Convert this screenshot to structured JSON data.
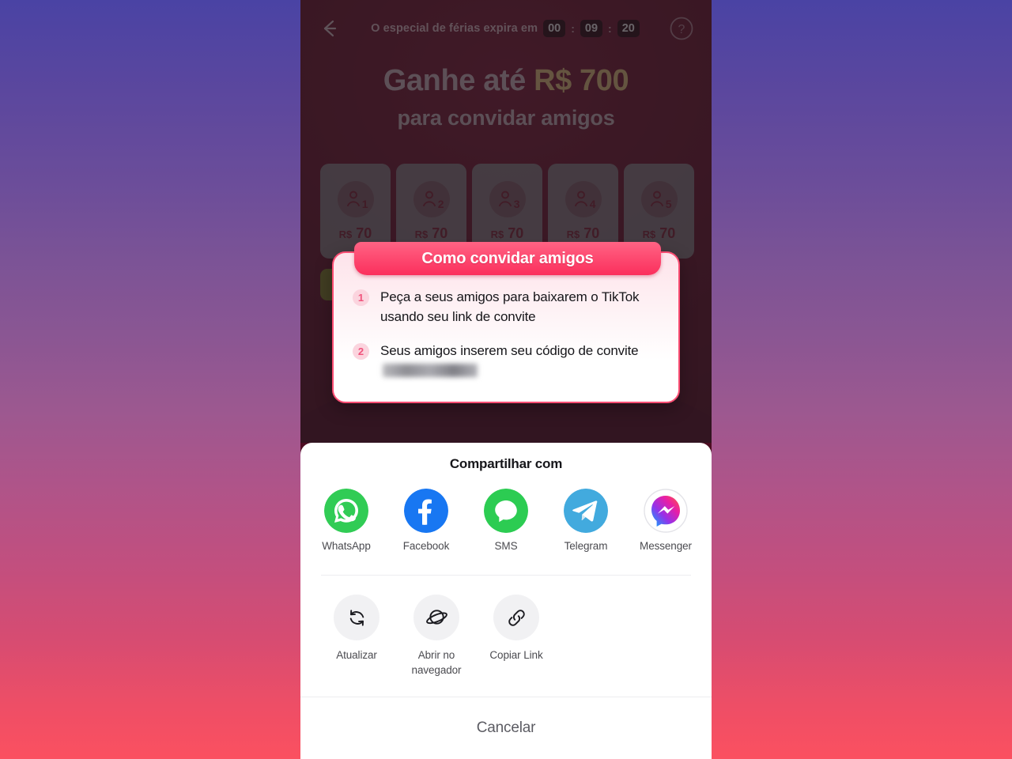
{
  "topbar": {
    "back_icon": "back-arrow-icon",
    "countdown_label": "O especial de férias expira em",
    "hours": "00",
    "minutes": "09",
    "seconds": "20",
    "separator": ":",
    "help_icon": "question-mark-icon"
  },
  "hero": {
    "line1_prefix": "Ganhe até ",
    "amount": "R$ 700",
    "line2": "para convidar amigos"
  },
  "reward_cards": [
    {
      "num": "1",
      "currency": "R$",
      "value": "70"
    },
    {
      "num": "2",
      "currency": "R$",
      "value": "70"
    },
    {
      "num": "3",
      "currency": "R$",
      "value": "70"
    },
    {
      "num": "4",
      "currency": "R$",
      "value": "70"
    },
    {
      "num": "5",
      "currency": "R$",
      "value": "70"
    }
  ],
  "tooltip": {
    "title": "Como convidar amigos",
    "steps": [
      {
        "num": "1",
        "text": "Peça a seus amigos para baixarem o TikTok usando seu link de convite"
      },
      {
        "num": "2",
        "text_before": "Seus amigos inserem seu código de convite ",
        "code_redacted": true
      }
    ]
  },
  "share_sheet": {
    "title": "Compartilhar com",
    "apps": [
      {
        "label": "WhatsApp",
        "icon": "whatsapp-icon",
        "color": "#31cc55"
      },
      {
        "label": "Facebook",
        "icon": "facebook-icon",
        "color": "#1877f2"
      },
      {
        "label": "SMS",
        "icon": "sms-icon",
        "color": "#2ccc52"
      },
      {
        "label": "Telegram",
        "icon": "telegram-icon",
        "color": "#42aade"
      },
      {
        "label": "Messenger",
        "icon": "messenger-icon",
        "color": "#a334f0"
      }
    ],
    "tools": [
      {
        "label": "Atualizar",
        "icon": "refresh-icon"
      },
      {
        "label": "Abrir no navegador",
        "icon": "browser-planet-icon"
      },
      {
        "label": "Copiar Link",
        "icon": "link-chain-icon"
      }
    ],
    "cancel_label": "Cancelar"
  },
  "colors": {
    "accent_pink": "#fb2f5c",
    "campaign_maroon": "#4d0d22",
    "bg_gradient_top": "#4a43a4",
    "bg_gradient_bottom": "#fb5060"
  }
}
